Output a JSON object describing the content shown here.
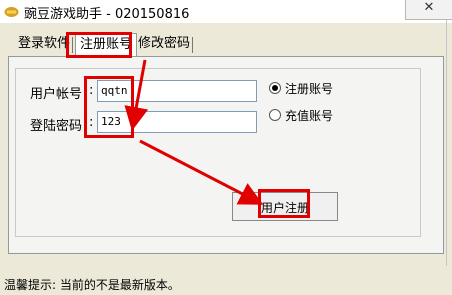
{
  "window": {
    "title": "豌豆游戏助手 - 020150816",
    "close_label": "✕"
  },
  "tabs": [
    {
      "label": "登录软件"
    },
    {
      "label": "注册账号"
    },
    {
      "label": "修改密码"
    }
  ],
  "form": {
    "username_label": "用户帐号",
    "username_value": "qqtn",
    "password_label": "登陆密码",
    "password_value": "123",
    "colon": ":",
    "radio_register": "注册账号",
    "radio_recharge": "充值账号",
    "selected_option": "注册账号"
  },
  "register_button_label": "用户注册",
  "status": {
    "text": "温馨提示: 当前的不是最新版本。"
  },
  "icons": {
    "app": "pea-pod-icon",
    "close": "close-icon"
  },
  "colors": {
    "annotation_red": "#e00000",
    "window_bg": "#ece9d8"
  }
}
